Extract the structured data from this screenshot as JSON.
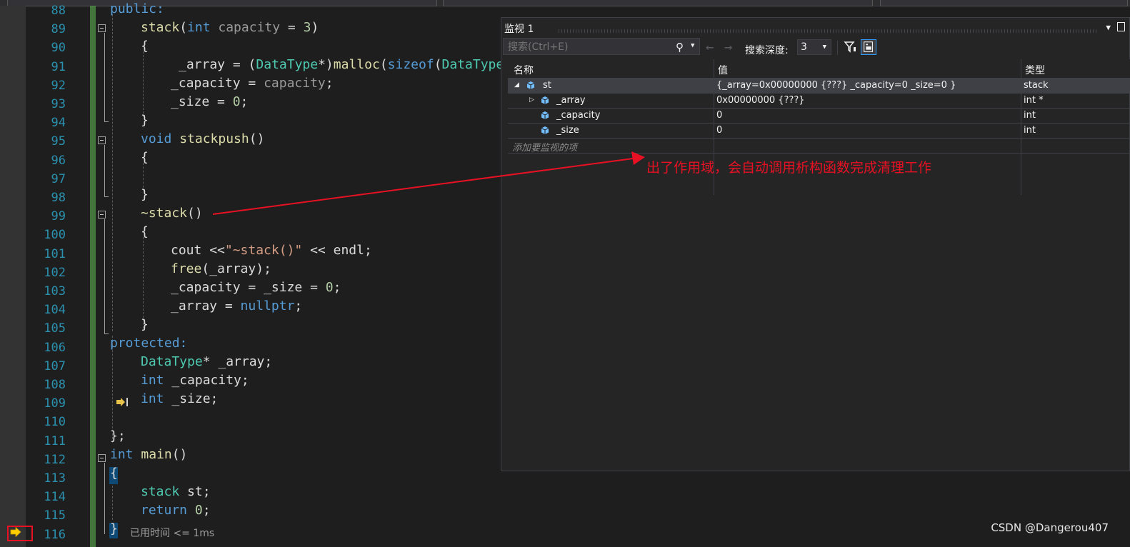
{
  "editor": {
    "lines": [
      {
        "no": "88"
      },
      {
        "no": "89"
      },
      {
        "no": "90"
      },
      {
        "no": "91"
      },
      {
        "no": "92"
      },
      {
        "no": "93"
      },
      {
        "no": "94"
      },
      {
        "no": "95"
      },
      {
        "no": "96"
      },
      {
        "no": "97"
      },
      {
        "no": "98"
      },
      {
        "no": "99"
      },
      {
        "no": "100"
      },
      {
        "no": "101"
      },
      {
        "no": "102"
      },
      {
        "no": "103"
      },
      {
        "no": "104"
      },
      {
        "no": "105"
      },
      {
        "no": "106"
      },
      {
        "no": "107"
      },
      {
        "no": "108"
      },
      {
        "no": "109"
      },
      {
        "no": "110"
      },
      {
        "no": "111"
      },
      {
        "no": "112"
      },
      {
        "no": "113"
      },
      {
        "no": "114"
      },
      {
        "no": "115"
      },
      {
        "no": "116"
      }
    ],
    "code": {
      "l88": "public:",
      "l89a": "stack",
      "l89b": "(",
      "l89c": "int",
      "l89d": " capacity",
      "l89e": " = ",
      "l89f": "3",
      "l89g": ")",
      "l90": "{",
      "l91a": "_array",
      "l91b": " = (",
      "l91c": "DataType",
      "l91d": "*)",
      "l91e": "malloc",
      "l91f": "(",
      "l91g": "sizeof",
      "l91h": "(",
      "l91i": "DataType",
      "l91j": ")",
      "l92a": "_capacity",
      "l92b": " = ",
      "l92c": "capacity",
      "l92d": ";",
      "l93a": "_size",
      "l93b": " = ",
      "l93c": "0",
      "l93d": ";",
      "l94": "}",
      "l95a": "void",
      "l95b": " stackpush",
      "l95c": "()",
      "l96": "{",
      "l98": "}",
      "l99a": "~stack",
      "l99b": "()",
      "l100": "{",
      "l101a": "cout",
      "l101b": " <<",
      "l101c": "\"~stack()\"",
      "l101d": " << ",
      "l101e": "endl",
      "l101f": ";",
      "l102a": "free",
      "l102b": "(",
      "l102c": "_array",
      "l102d": ");",
      "l103a": "_capacity",
      "l103b": " = ",
      "l103c": "_size",
      "l103d": " = ",
      "l103e": "0",
      "l103f": ";",
      "l104a": "_array",
      "l104b": " = ",
      "l104c": "nullptr",
      "l104d": ";",
      "l105": "}",
      "l106": "protected:",
      "l107a": "DataType",
      "l107b": "* _array;",
      "l108a": "int",
      "l108b": " _capacity;",
      "l109a": "int",
      "l109b": " _size;",
      "l111": "};",
      "l112a": "int",
      "l112b": " main",
      "l112c": "()",
      "l113": "{",
      "l114a": "stack",
      "l114b": " st;",
      "l115a": "return",
      "l115b": " ",
      "l115c": "0",
      "l115d": ";",
      "l116": "}"
    },
    "elapsed": "已用时间 <= 1ms"
  },
  "watch": {
    "title": "监视 1",
    "search_placeholder": "搜索(Ctrl+E)",
    "depth_label": "搜索深度:",
    "depth_value": "3",
    "columns": [
      "名称",
      "值",
      "类型"
    ],
    "rows": [
      {
        "name": "st",
        "value": "{_array=0x00000000 {???} _capacity=0 _size=0 }",
        "type": "stack"
      },
      {
        "name": "_array",
        "value": "0x00000000 {???}",
        "type": "int *"
      },
      {
        "name": "_capacity",
        "value": "0",
        "type": "int"
      },
      {
        "name": "_size",
        "value": "0",
        "type": "int"
      }
    ],
    "add_placeholder": "添加要监视的项"
  },
  "annotation": "出了作用域，会自动调用析构函数完成清理工作",
  "watermark": "CSDN @Dangerou407",
  "colors": {
    "accent_red": "#e81123",
    "line_number": "#2b91af",
    "keyword": "#569cd6",
    "type": "#4ec9b0"
  }
}
